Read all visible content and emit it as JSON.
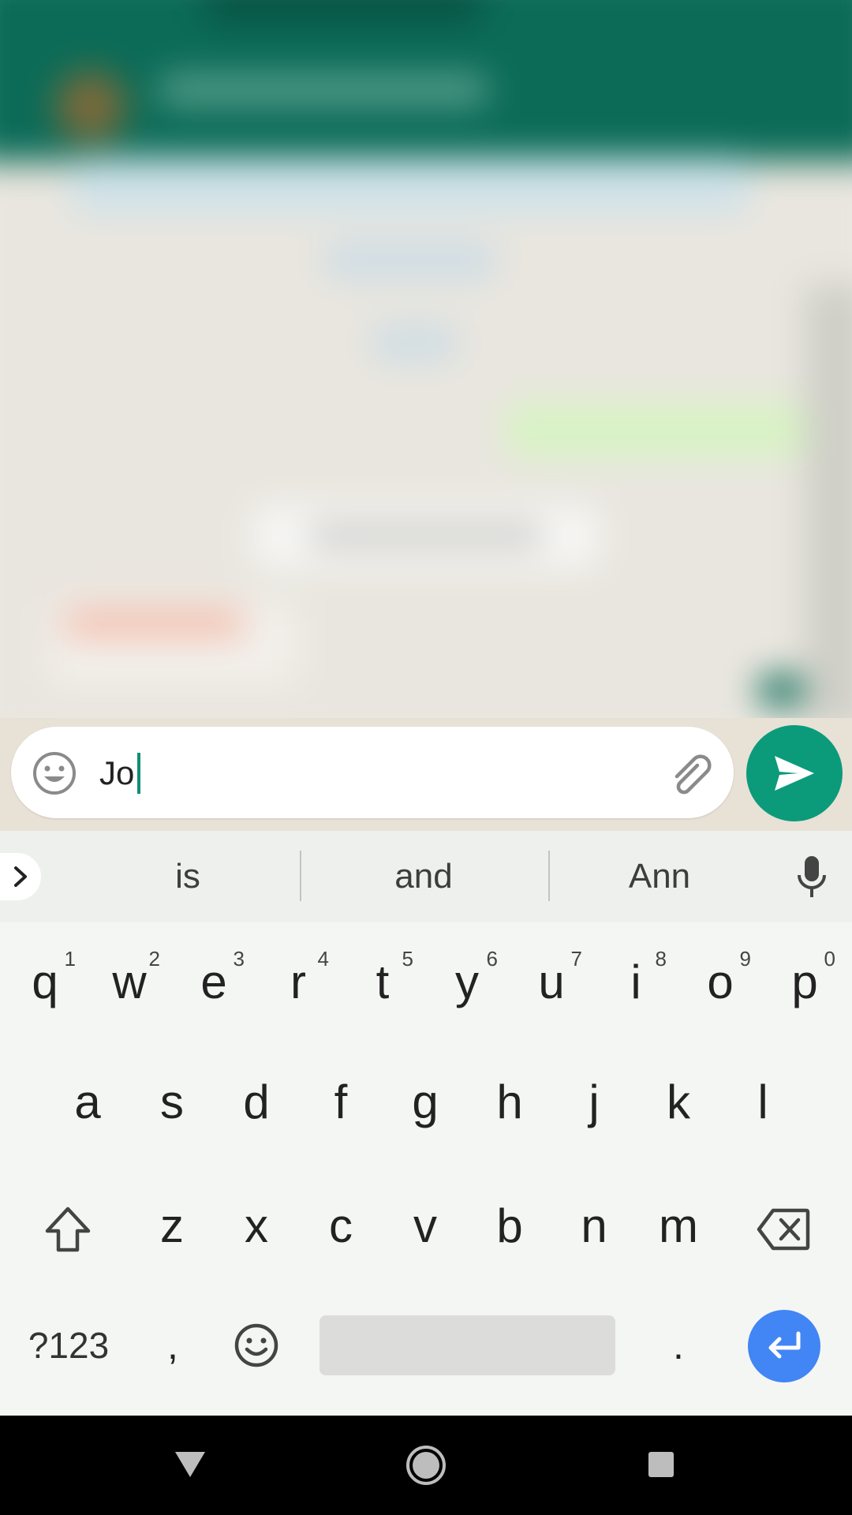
{
  "composer": {
    "message_text": "Jo"
  },
  "suggestions": [
    "is",
    "and",
    "Ann"
  ],
  "keyboard": {
    "row1": [
      {
        "key": "q",
        "hint": "1"
      },
      {
        "key": "w",
        "hint": "2"
      },
      {
        "key": "e",
        "hint": "3"
      },
      {
        "key": "r",
        "hint": "4"
      },
      {
        "key": "t",
        "hint": "5"
      },
      {
        "key": "y",
        "hint": "6"
      },
      {
        "key": "u",
        "hint": "7"
      },
      {
        "key": "i",
        "hint": "8"
      },
      {
        "key": "o",
        "hint": "9"
      },
      {
        "key": "p",
        "hint": "0"
      }
    ],
    "row2": [
      "a",
      "s",
      "d",
      "f",
      "g",
      "h",
      "j",
      "k",
      "l"
    ],
    "row3": [
      "z",
      "x",
      "c",
      "v",
      "b",
      "n",
      "m"
    ],
    "symbols_label": "?123",
    "comma": ",",
    "period": "."
  },
  "colors": {
    "header_green": "#0b6b57",
    "send_green": "#0b9b7b",
    "enter_blue": "#4285f4",
    "caret_green": "#0f8f74"
  },
  "icons": [
    "emoji-icon",
    "attach-icon",
    "send-icon",
    "expand-chevron-icon",
    "mic-icon",
    "shift-icon",
    "backspace-icon",
    "emoji-key-icon",
    "enter-icon",
    "nav-back-icon",
    "nav-home-icon",
    "nav-recents-icon"
  ]
}
